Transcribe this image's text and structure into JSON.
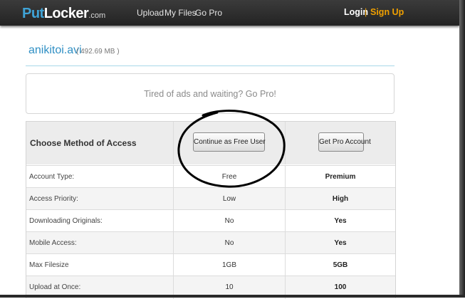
{
  "header": {
    "logo": {
      "part1": "Put",
      "part2": "Locker",
      "part3": ".com"
    },
    "nav": {
      "upload": "Upload",
      "my_files": "My Files",
      "go_pro": "Go Pro"
    },
    "auth": {
      "login": "Login",
      "separator": "|",
      "signup": "Sign Up"
    }
  },
  "file": {
    "name": "anikitoi.avi",
    "size": "( 492.69 MB )"
  },
  "ad": {
    "text": "Tired of ads and waiting? Go Pro!"
  },
  "access": {
    "title": "Choose Method of Access",
    "free_button": "Continue as Free User",
    "pro_button": "Get Pro Account",
    "rows": [
      {
        "label": "Account Type:",
        "free": "Free",
        "pro": "Premium"
      },
      {
        "label": "Access Priority:",
        "free": "Low",
        "pro": "High"
      },
      {
        "label": "Downloading Originals:",
        "free": "No",
        "pro": "Yes"
      },
      {
        "label": "Mobile Access:",
        "free": "No",
        "pro": "Yes"
      },
      {
        "label": "Max Filesize",
        "free": "1GB",
        "pro": "5GB"
      },
      {
        "label": "Upload at Once:",
        "free": "10",
        "pro": "100"
      }
    ]
  },
  "colors": {
    "topbar": "#2b2b2b",
    "logo_accent": "#3fa3d6",
    "signup": "#f0a000",
    "filename": "#2f8fc4"
  }
}
